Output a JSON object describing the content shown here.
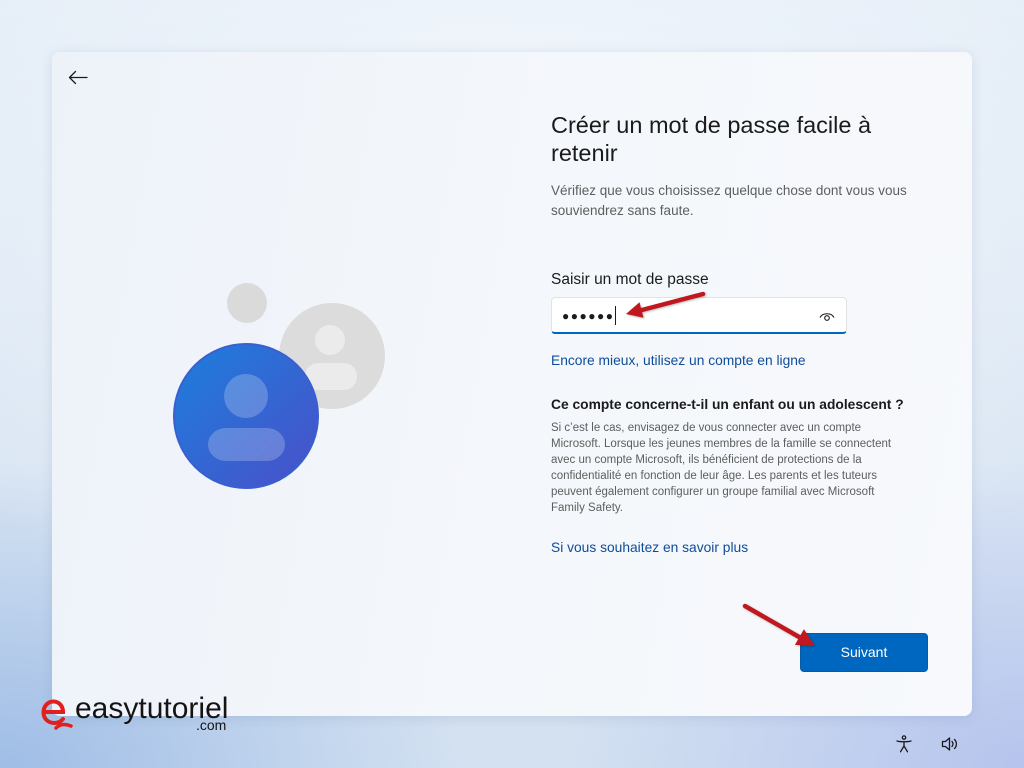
{
  "icons": {
    "back": "back-arrow-icon",
    "reveal_password": "eye-icon",
    "illustration": "user-avatars-illustration",
    "accessibility": "accessibility-icon",
    "volume": "volume-icon",
    "watermark_logo": "easytutoriel-logo-icon"
  },
  "colors": {
    "accent": "#0067c0",
    "link": "#0f4c9a",
    "annotation_arrow": "#c0181e",
    "avatar_blue": "#1c7fdc"
  },
  "page": {
    "title": "Créer un mot de passe facile à retenir",
    "subtitle": "Vérifiez que vous choisissez quelque chose dont vous vous souviendrez sans faute."
  },
  "password": {
    "label": "Saisir un mot de passe",
    "value_display": "●●●●●●"
  },
  "online_account_link": "Encore mieux, utilisez un compte en ligne",
  "child_account": {
    "heading": "Ce compte concerne-t-il un enfant ou un adolescent ?",
    "body": "Si c’est le cas, envisagez de vous connecter avec un compte Microsoft. Lorsque les jeunes membres de la famille se connectent avec un compte Microsoft, ils bénéficient de protections de la confidentialité en fonction de leur âge. Les parents et les tuteurs peuvent également configurer un groupe familial avec Microsoft Family Safety.",
    "learn_more_link": "Si vous souhaitez en savoir plus"
  },
  "footer": {
    "next_button": "Suivant"
  },
  "watermark": {
    "brand": "easytutoriel",
    "suffix": ".com"
  }
}
